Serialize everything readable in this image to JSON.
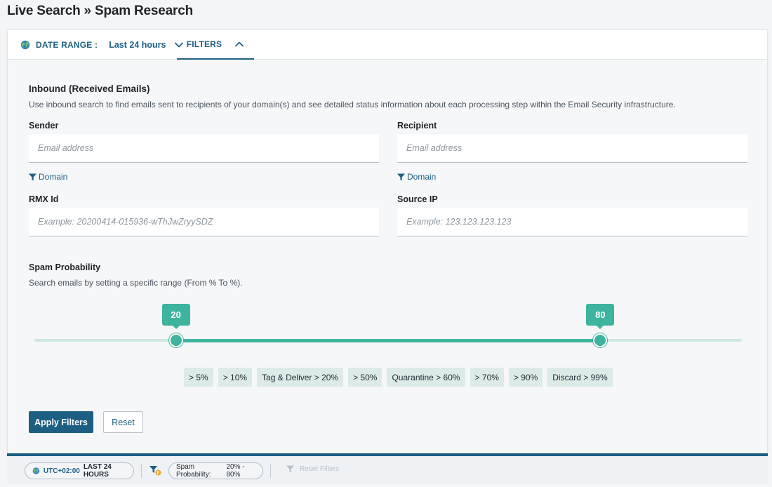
{
  "page": {
    "title": "Live Search » Spam Research"
  },
  "tabs": {
    "date_range_label": "DATE RANGE :",
    "date_range_value": "Last 24 hours",
    "filters_label": "FILTERS"
  },
  "form": {
    "section_title": "Inbound (Received Emails)",
    "section_description": "Use inbound search to find emails sent to recipients of your domain(s) and see detailed status information about each processing step within the Email Security infrastructure.",
    "sender": {
      "label": "Sender",
      "placeholder": "Email address",
      "value": "",
      "domain_link": "Domain"
    },
    "recipient": {
      "label": "Recipient",
      "placeholder": "Email address",
      "value": "",
      "domain_link": "Domain"
    },
    "rmx_id": {
      "label": "RMX Id",
      "placeholder": "Example: 20200414-015936-wThJwZryySDZ",
      "value": ""
    },
    "source_ip": {
      "label": "Source IP",
      "placeholder": "Example: 123.123.123.123",
      "value": ""
    }
  },
  "spam_probability": {
    "title": "Spam Probability",
    "description": "Search emails by setting a specific range (From % To %).",
    "min": 0,
    "max": 100,
    "from": 20,
    "to": 80,
    "from_label": "20",
    "to_label": "80",
    "presets": [
      "> 5%",
      "> 10%",
      "Tag & Deliver > 20%",
      "> 50%",
      "Quarantine > 60%",
      "> 70%",
      "> 90%",
      "Discard > 99%"
    ]
  },
  "actions": {
    "apply_label": "Apply Filters",
    "reset_label": "Reset"
  },
  "statusbar": {
    "timezone": "UTC+02:00",
    "range": "LAST 24 HOURS",
    "filter_name": "Spam Probability:",
    "filter_value": "20% - 80%",
    "reset_filters": "Reset Filters"
  },
  "colors": {
    "primary": "#1d5f83",
    "accent": "#3eb39d",
    "track": "#cde8e2",
    "preset_bg": "#dcebe7"
  }
}
